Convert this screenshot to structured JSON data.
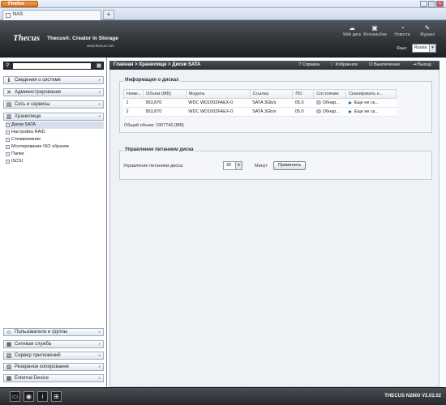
{
  "browser": {
    "app_button": "Firefox",
    "tab_title": "NAS",
    "new_tab": "+",
    "win_min": "_",
    "win_max": "□",
    "win_close": "×"
  },
  "header": {
    "logo": "Thecus",
    "slogan": "Thecus®. Creator in Storage",
    "url": "www.thecus.com",
    "icons": [
      {
        "label": "Web диск",
        "icon": "cloud-icon"
      },
      {
        "label": "Фотоальбом",
        "icon": "photo-icon"
      },
      {
        "label": "Новости",
        "icon": "rss-icon"
      },
      {
        "label": "Журнал",
        "icon": "speech-icon"
      }
    ],
    "lang_label": "Язык:",
    "lang_value": "Russia"
  },
  "sidebar": {
    "search_placeholder": "",
    "sections_top": [
      {
        "label": "Сведения о системе",
        "icon": "info-icon"
      },
      {
        "label": "Администрирование",
        "icon": "tools-icon"
      },
      {
        "label": "Сеть и сервисы",
        "icon": "network-icon"
      },
      {
        "label": "Хранилище",
        "icon": "storage-icon"
      }
    ],
    "storage_items": [
      {
        "label": "Диски SATA",
        "selected": true
      },
      {
        "label": "Настройка RAID",
        "selected": false
      },
      {
        "label": "Стекирование",
        "selected": false
      },
      {
        "label": "Монтирование ISO образов",
        "selected": false
      },
      {
        "label": "Папки",
        "selected": false
      },
      {
        "label": "iSCSI",
        "selected": false
      }
    ],
    "sections_bottom": [
      {
        "label": "Пользователи и группы",
        "icon": "users-icon"
      },
      {
        "label": "Сетевая служба",
        "icon": "service-icon"
      },
      {
        "label": "Сервер приложений",
        "icon": "app-server-icon"
      },
      {
        "label": "Резервное копирование",
        "icon": "backup-icon"
      },
      {
        "label": "External Device",
        "icon": "device-icon"
      }
    ]
  },
  "breadcrumb": {
    "path": "Главная > Хранилище > Диски SATA",
    "help": "Справка",
    "favorites": "Избранное",
    "shutdown": "Выключение",
    "logout": "Выход"
  },
  "disk_info": {
    "title": "Информация о дисках",
    "columns": [
      "Номе...",
      "Объем (MB)",
      "Модель",
      "Ссылка",
      "ПО",
      "Состояние",
      "Сканировать н..."
    ],
    "rows": [
      {
        "num": "1",
        "size": "953,870",
        "model": "WDC WD1002FAEX-0",
        "link": "SATA 3Gb/s",
        "fw": "05.0",
        "state": "Обнар...",
        "scan": "Еще не ск..."
      },
      {
        "num": "2",
        "size": "953,870",
        "model": "WDC WD1002FAEX-0",
        "link": "SATA 3Gb/s",
        "fw": "05.0",
        "state": "Обнар...",
        "scan": "Еще не ск..."
      }
    ],
    "total": "Общий объем: 1907740 (MB)"
  },
  "power": {
    "title": "Управление питанием диска",
    "label": "Управление питанием диска:",
    "value": "30",
    "unit": "Минут",
    "apply": "Применить"
  },
  "footer": {
    "icons": [
      "screen-icon",
      "disc-icon",
      "info-icon",
      "network-icon"
    ],
    "version": "THECUS N2800 V2.02.02"
  }
}
